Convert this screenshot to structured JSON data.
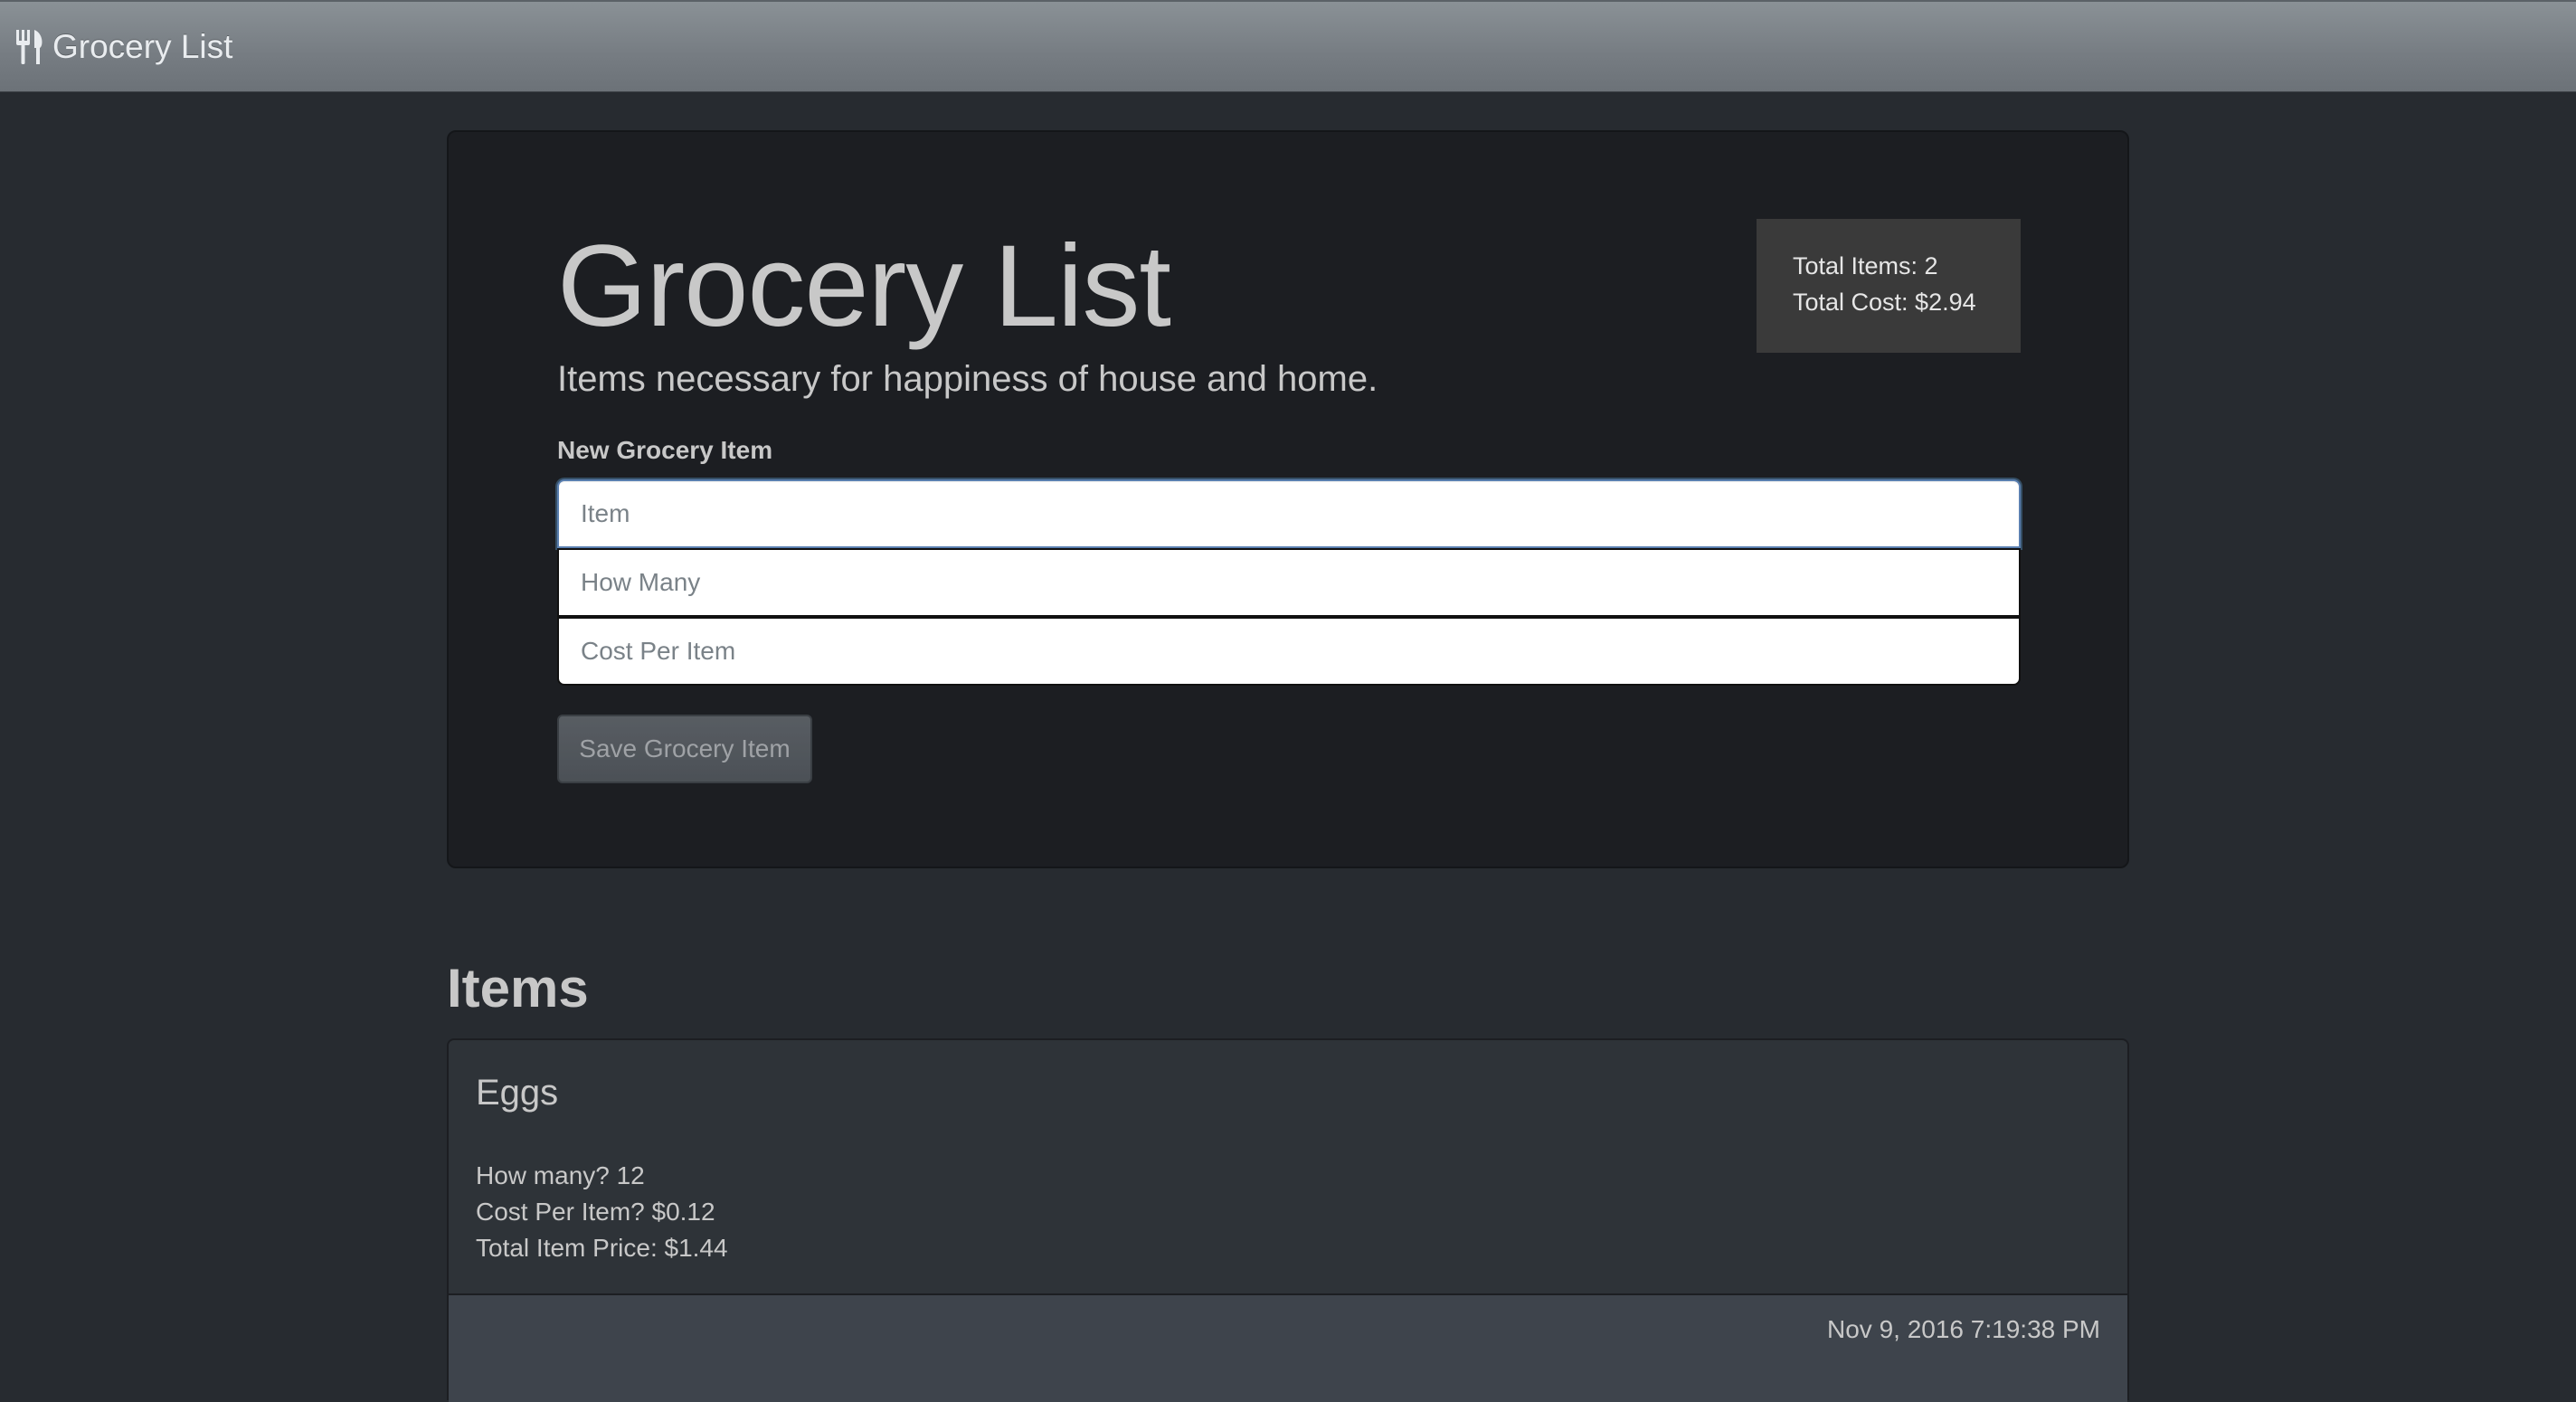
{
  "navbar": {
    "brand": "Grocery List",
    "brand_icon": "cutlery-icon"
  },
  "header": {
    "title": "Grocery List",
    "subtitle": "Items necessary for happiness of house and home."
  },
  "summary": {
    "total_items": "Total Items: 2",
    "total_cost": "Total Cost: $2.94"
  },
  "form": {
    "label": "New Grocery Item",
    "item_placeholder": "Item",
    "qty_placeholder": "How Many",
    "cost_placeholder": "Cost Per Item",
    "item_value": "",
    "qty_value": "",
    "cost_value": "",
    "save_label": "Save Grocery Item"
  },
  "items_section": {
    "heading": "Items",
    "items": [
      {
        "name": "Eggs",
        "how_many": "How many? 12",
        "cost_per_item": "Cost Per Item? $0.12",
        "total_price": "Total Item Price: $1.44",
        "timestamp": "Nov 9, 2016 7:19:38 PM"
      }
    ]
  }
}
